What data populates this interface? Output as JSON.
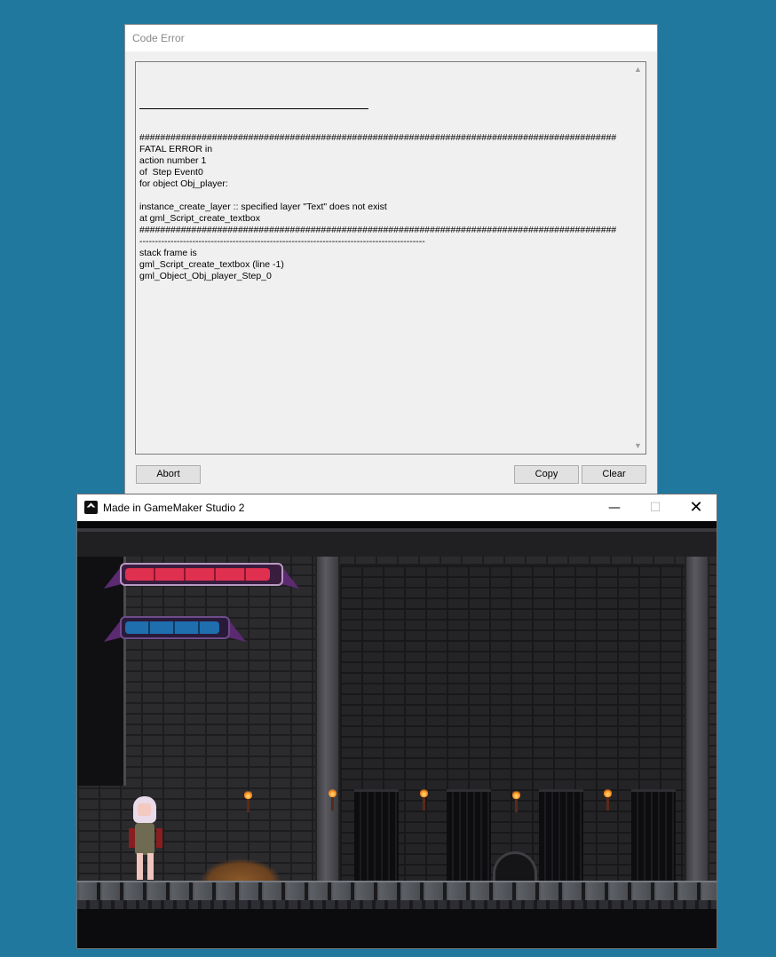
{
  "error_dialog": {
    "title": "Code Error",
    "message_lines": [
      "############################################################################################",
      "FATAL ERROR in",
      "action number 1",
      "of  Step Event0",
      "for object Obj_player:",
      "",
      "instance_create_layer :: specified layer \"Text\" does not exist",
      "at gml_Script_create_textbox",
      "############################################################################################",
      "--------------------------------------------------------------------------------------------",
      "stack frame is",
      "gml_Script_create_textbox (line -1)",
      "gml_Object_Obj_player_Step_0"
    ],
    "buttons": {
      "abort": "Abort",
      "copy": "Copy",
      "clear": "Clear"
    }
  },
  "game_window": {
    "title": "Made in GameMaker Studio 2",
    "controls": {
      "minimize": "—",
      "maximize": "☐",
      "close": "✕"
    },
    "hud": {
      "health_fraction": 0.95,
      "mana_fraction": 0.95
    },
    "colors": {
      "health": "#e0304f",
      "mana": "#1f6fae",
      "desktop": "#21789f"
    }
  }
}
